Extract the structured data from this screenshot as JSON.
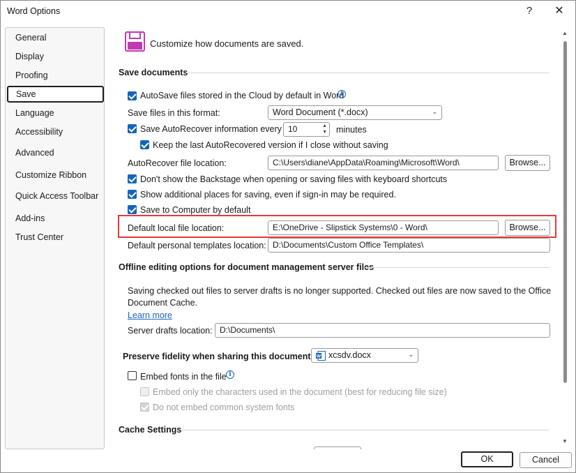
{
  "window": {
    "title": "Word Options",
    "help_glyph": "?",
    "close_glyph": "✕"
  },
  "sidebar": {
    "items": [
      {
        "label": "General"
      },
      {
        "label": "Display"
      },
      {
        "label": "Proofing"
      },
      {
        "label": "Save",
        "active": true
      },
      {
        "label": "Language"
      },
      {
        "label": "Accessibility"
      },
      {
        "label": "Advanced"
      },
      {
        "label": "Customize Ribbon"
      },
      {
        "label": "Quick Access Toolbar"
      },
      {
        "label": "Add-ins"
      },
      {
        "label": "Trust Center"
      }
    ]
  },
  "header": {
    "icon": "save-document-icon",
    "text": "Customize how documents are saved."
  },
  "save_documents": {
    "heading": "Save documents",
    "autosave_label": "AutoSave files stored in the Cloud by default in Word",
    "autosave_checked": true,
    "format_label": "Save files in this format:",
    "format_value": "Word Document (*.docx)",
    "autorecover_label": "Save AutoRecover information every",
    "autorecover_checked": true,
    "autorecover_minutes": "10",
    "minutes_label": "minutes",
    "keep_last_label": "Keep the last AutoRecovered version if I close without saving",
    "keep_last_checked": true,
    "autorecover_location_label": "AutoRecover file location:",
    "autorecover_location_value": "C:\\Users\\diane\\AppData\\Roaming\\Microsoft\\Word\\",
    "browse_label": "Browse...",
    "backstage_label": "Don't show the Backstage when opening or saving files with keyboard shortcuts",
    "backstage_checked": true,
    "additional_places_label": "Show additional places for saving, even if sign-in may be required.",
    "additional_places_checked": true,
    "save_to_computer_label": "Save to Computer by default",
    "save_to_computer_checked": true,
    "default_local_label": "Default local file location:",
    "default_local_value": "E:\\OneDrive - Slipstick Systems\\0 - Word\\",
    "default_templates_label": "Default personal templates location:",
    "default_templates_value": "D:\\Documents\\Custom Office Templates\\"
  },
  "offline_editing": {
    "heading": "Offline editing options for document management server files",
    "notice_line1": "Saving checked out files to server drafts is no longer supported. Checked out files are now saved to the Office",
    "notice_line2": "Document Cache.",
    "learn_more": "Learn more",
    "drafts_label": "Server drafts location:",
    "drafts_value": "D:\\Documents\\"
  },
  "fidelity": {
    "heading": "Preserve fidelity when sharing this document:",
    "document_value": "xcsdv.docx",
    "embed_fonts_label": "Embed fonts in the file",
    "embed_fonts_checked": false,
    "embed_used_label": "Embed only the characters used in the document (best for reducing file size)",
    "no_common_label": "Do not embed common system fonts"
  },
  "cache": {
    "heading": "Cache Settings"
  },
  "footer": {
    "ok_label": "OK",
    "cancel_label": "Cancel"
  },
  "colors": {
    "accent": "#1565c0",
    "highlight": "#e53935",
    "save_icon": "#c239b3"
  }
}
